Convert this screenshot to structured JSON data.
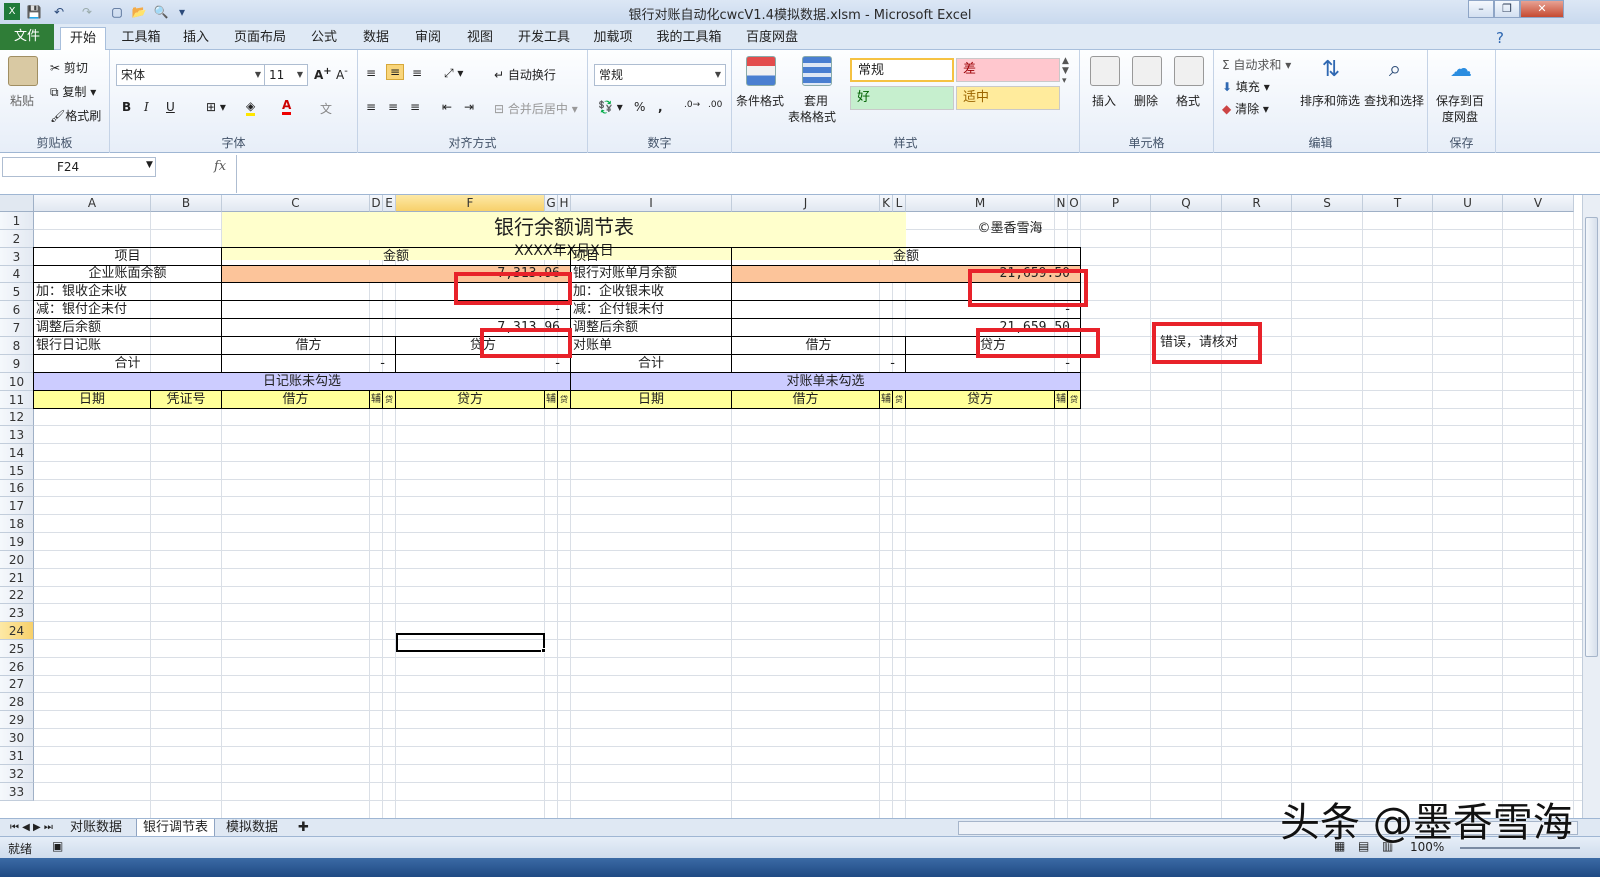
{
  "window": {
    "title": "银行对账自动化cwcV1.4模拟数据.xlsm  -  Microsoft Excel"
  },
  "ribbon_tabs": [
    {
      "label": "文件",
      "kind": "file"
    },
    {
      "label": "开始",
      "kind": "active"
    },
    {
      "label": "工具箱"
    },
    {
      "label": "插入"
    },
    {
      "label": "页面布局"
    },
    {
      "label": "公式"
    },
    {
      "label": "数据"
    },
    {
      "label": "审阅"
    },
    {
      "label": "视图"
    },
    {
      "label": "开发工具"
    },
    {
      "label": "加载项"
    },
    {
      "label": "我的工具箱"
    },
    {
      "label": "百度网盘"
    }
  ],
  "ribbon": {
    "clipboard": {
      "label": "剪贴板",
      "paste": "粘贴",
      "cut": "剪切",
      "copy": "复制",
      "format_painter": "格式刷"
    },
    "font": {
      "label": "字体",
      "name": "宋体",
      "size": "11",
      "bold": "B",
      "italic": "I",
      "underline": "U"
    },
    "alignment": {
      "label": "对齐方式",
      "wrap": "自动换行",
      "merge": "合并后居中"
    },
    "number": {
      "label": "数字",
      "format": "常规",
      "percent": "%",
      "comma": ","
    },
    "styles": {
      "label": "样式",
      "conditional": "条件格式",
      "table_format_1": "套用",
      "table_format_2": "表格格式",
      "normal": "常规",
      "bad": "差",
      "good": "好",
      "neutral": "适中"
    },
    "cells": {
      "label": "单元格",
      "insert": "插入",
      "delete": "删除",
      "format": "格式"
    },
    "editing": {
      "label": "编辑",
      "autosum": "自动求和",
      "fill": "填充",
      "clear": "清除",
      "sort_filter": "排序和筛选",
      "find_select": "查找和选择"
    },
    "save": {
      "label": "保存",
      "save_baidu_1": "保存到百",
      "save_baidu_2": "度网盘"
    }
  },
  "formula_bar": {
    "name_box": "F24",
    "fx": "fx",
    "formula": ""
  },
  "columns": [
    "A",
    "B",
    "C",
    "D",
    "E",
    "F",
    "G",
    "H",
    "I",
    "J",
    "K",
    "L",
    "M",
    "N",
    "O",
    "P",
    "Q",
    "R",
    "S",
    "T",
    "U",
    "V"
  ],
  "rows": [
    "1",
    "2",
    "3",
    "4",
    "5",
    "6",
    "7",
    "8",
    "9",
    "10",
    "11",
    "12",
    "13",
    "14",
    "15",
    "16",
    "17",
    "18",
    "19",
    "20",
    "21",
    "22",
    "23",
    "24",
    "25",
    "26",
    "27",
    "28",
    "29",
    "30",
    "31",
    "32",
    "33"
  ],
  "selected_cell": {
    "column": "F",
    "row": "24"
  },
  "sheet": {
    "title": "银行余额调节表",
    "date": "XXXX年X月X日",
    "brand": "©墨香雪海",
    "r3": {
      "item_left": "项目",
      "amount_left": "金额",
      "item_right": "项目",
      "amount_right": "金额"
    },
    "r4": {
      "label_left": "企业账面余额",
      "value_left": "7,313.96",
      "label_right": "银行对账单月余额",
      "value_right": "21,659.50"
    },
    "r5": {
      "label_left": "加：银收企未收",
      "label_right": "加：企收银未收"
    },
    "r6": {
      "label_left": "减：银付企未付",
      "value_left": "-",
      "label_right": "减：企付银未付",
      "value_right": "-"
    },
    "r7": {
      "label_left": "调整后余额",
      "value_left": "7,313.96",
      "label_right": "调整后余额",
      "value_right": "21,659.50",
      "error": "错误，请核对"
    },
    "r8": {
      "journal": "银行日记账",
      "debit_l": "借方",
      "credit_l": "贷方",
      "statement": "对账单",
      "debit_r": "借方",
      "credit_r": "贷方"
    },
    "r9": {
      "total_l": "合计",
      "debit_l": "-",
      "credit_l": "-",
      "total_r": "合计",
      "debit_r": "-",
      "credit_r": "-"
    },
    "r10": {
      "left": "日记账未勾选",
      "right": "对账单未勾选"
    },
    "r11": {
      "date_l": "日期",
      "voucher": "凭证号",
      "debit_l": "借方",
      "aux1": "辅",
      "flag1": "贷",
      "credit_l": "贷方",
      "aux2": "辅",
      "flag2": "贷",
      "date_r": "日期",
      "debit_r": "借方",
      "aux3": "辅",
      "flag3": "贷",
      "credit_r": "贷方",
      "aux4": "辅",
      "flag4": "贷"
    }
  },
  "sheet_tabs": [
    {
      "label": "对账数据"
    },
    {
      "label": "银行调节表",
      "active": true
    },
    {
      "label": "模拟数据"
    }
  ],
  "status": {
    "ready": "就绪",
    "zoom": "100%"
  },
  "watermark": "头条 @墨香雪海",
  "colors": {
    "title_fill": "#ffffcc",
    "orange_fill": "#fcc49a",
    "lavender_fill": "#ccccff",
    "yellow_fill": "#ffff99",
    "red_box": "#e8222a",
    "file_tab": "#2f7d37"
  }
}
